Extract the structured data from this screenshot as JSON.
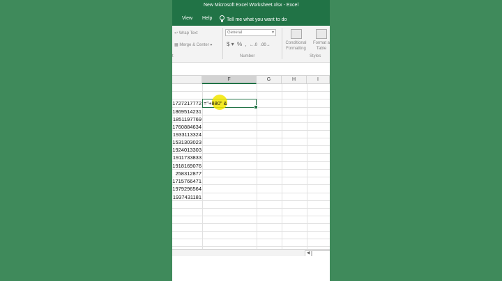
{
  "window": {
    "title": "New Microsoft Excel Worksheet.xlsx  -  Excel"
  },
  "menu": {
    "items": [
      "View",
      "Help"
    ],
    "tell_me": "Tell me what you want to do"
  },
  "ribbon": {
    "wrap_text": "Wrap Text",
    "merge_center": "Merge & Center",
    "alignment_group": "t",
    "number_format": "General",
    "number_group": "Number",
    "conditional_formatting": [
      "Conditional",
      "Formatting"
    ],
    "format_as_table": [
      "Format a",
      "Table"
    ],
    "styles_group": "Styles"
  },
  "columns": [
    "F",
    "G",
    "H",
    "I"
  ],
  "column_e_values": [
    "1727217772",
    "1869514231",
    "1851197769",
    "1760884634",
    "1933113324",
    "1531303023",
    "1924013303",
    "1911733833",
    "1918169076",
    "258312877",
    "1715766471",
    "1979296564",
    "1937431181"
  ],
  "active_cell": {
    "formula": "=\"+880\" &"
  },
  "colors": {
    "excel_green": "#217346",
    "page_bg": "#3f8a5b",
    "highlight": "#f2e600"
  }
}
